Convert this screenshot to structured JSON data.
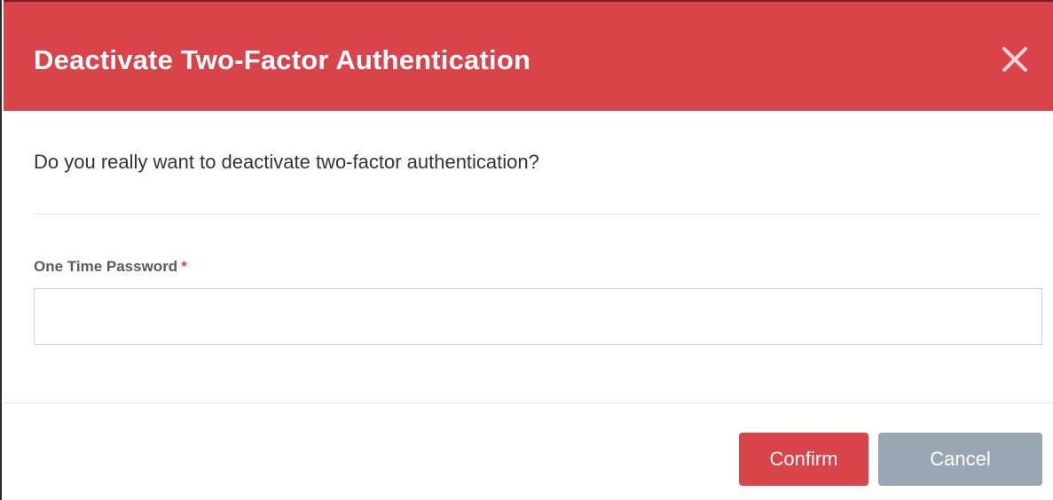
{
  "dialog": {
    "title": "Deactivate Two-Factor Authentication",
    "close_icon": "close-icon",
    "question": "Do you really want to deactivate two-factor authentication?",
    "field": {
      "label": "One Time Password",
      "required_marker": "*",
      "value": "",
      "placeholder": ""
    },
    "buttons": {
      "confirm_label": "Confirm",
      "cancel_label": "Cancel"
    }
  },
  "colors": {
    "header": "#d9434a",
    "confirm_button": "#d9434a",
    "cancel_button": "#9aa7b2",
    "required_marker": "#d9434a"
  }
}
